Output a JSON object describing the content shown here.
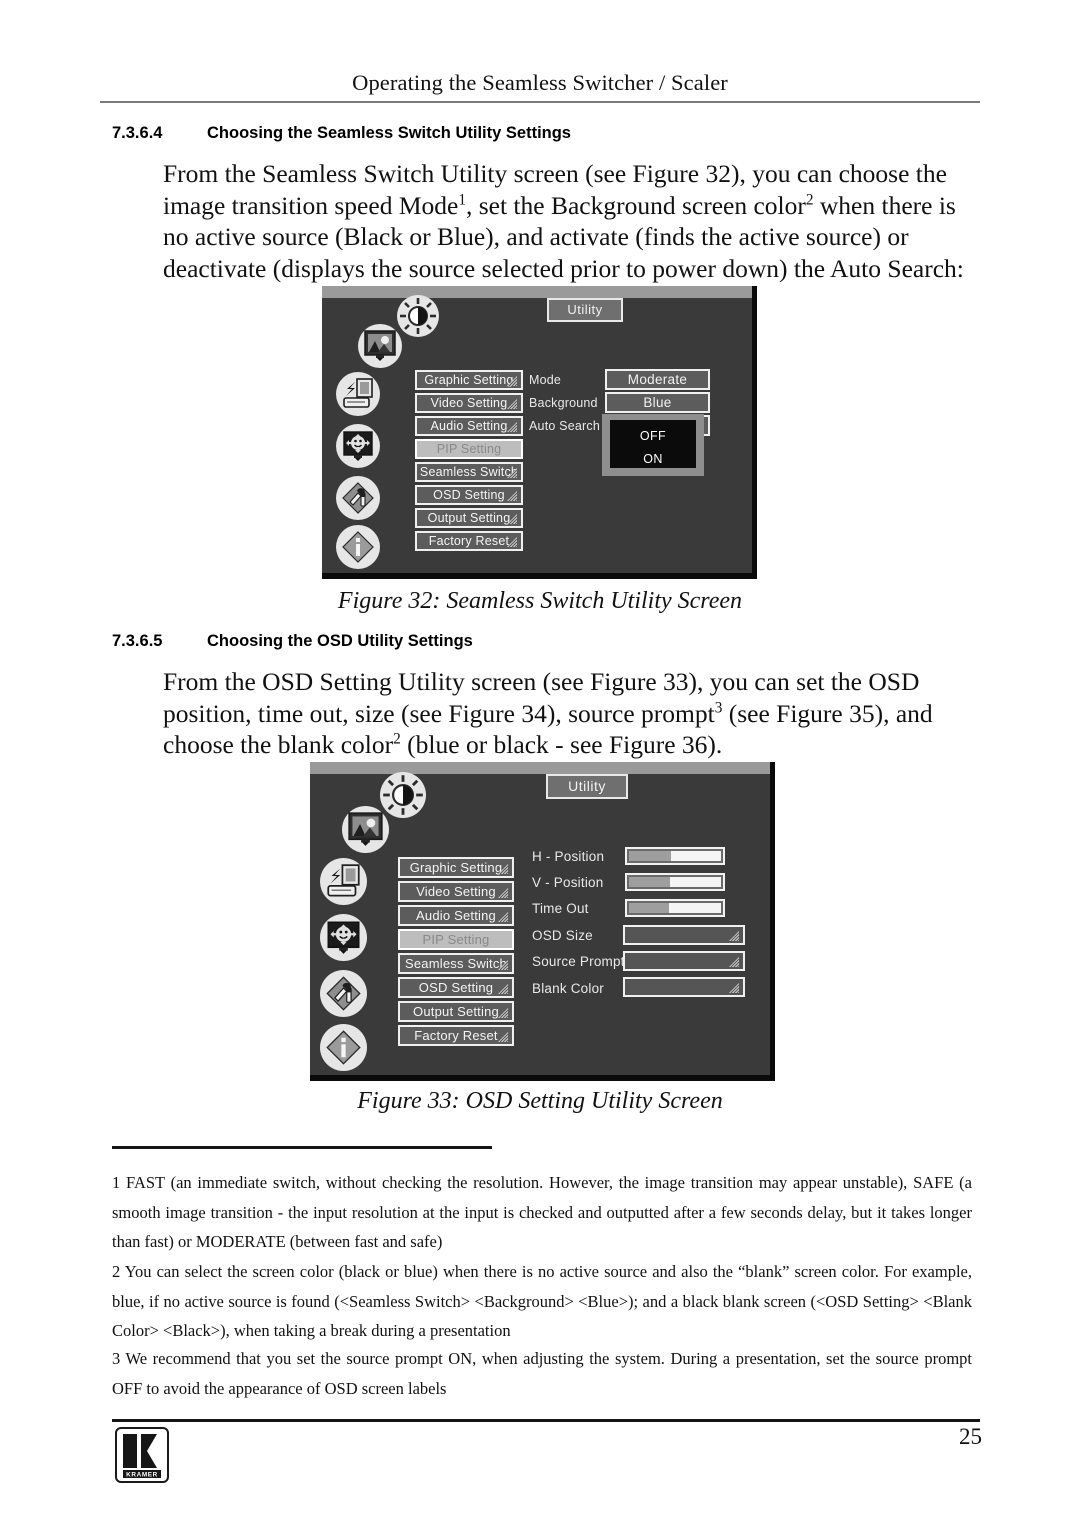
{
  "page": {
    "running_head": "Operating the Seamless Switcher / Scaler",
    "number": "25",
    "logo_text": "KRAMER"
  },
  "sections": [
    {
      "number": "7.3.6.4",
      "title": "Choosing the Seamless Switch Utility Settings",
      "body_line1": "From the Seamless Switch Utility screen (see Figure 32), you can choose the",
      "body_line2_a": "image transition speed Mode",
      "body_line2_sup1": "1",
      "body_line2_b": ", set the Background screen color",
      "body_line2_sup2": "2",
      "body_line2_c": " when there is",
      "body_line3": "no active source (Black or Blue), and activate (finds the active source) or",
      "body_line4": "deactivate (displays the source selected prior to power down) the Auto Search:"
    },
    {
      "number": "7.3.6.5",
      "title": "Choosing the OSD Utility Settings",
      "body_line1": "From the OSD Setting Utility screen (see Figure 33), you can set the OSD",
      "body_line2_a": "position, time out, size (see Figure 34), source prompt",
      "body_line2_sup3": "3",
      "body_line2_b": " (see Figure 35), and",
      "body_line3_a": "choose the blank color",
      "body_line3_sup2": "2",
      "body_line3_b": " (blue or black - see Figure 36)."
    }
  ],
  "figures": [
    {
      "caption": "Figure 32: Seamless Switch Utility Screen",
      "screen": {
        "title": "Utility",
        "rail_icons": [
          "brightness-contrast-icon",
          "picture-monitor-icon",
          "input-source-icon",
          "pip-monitor-icon",
          "tools-icon",
          "information-icon"
        ],
        "menu_items": [
          {
            "label": "Graphic Setting",
            "selected": false,
            "has_submenu": true
          },
          {
            "label": "Video Setting",
            "selected": false,
            "has_submenu": true
          },
          {
            "label": "Audio Setting",
            "selected": false,
            "has_submenu": true
          },
          {
            "label": "PIP Setting",
            "selected": true,
            "has_submenu": false
          },
          {
            "label": "Seamless Switch",
            "selected": false,
            "has_submenu": true
          },
          {
            "label": "OSD Setting",
            "selected": false,
            "has_submenu": true
          },
          {
            "label": "Output Setting",
            "selected": false,
            "has_submenu": true
          },
          {
            "label": "Factory Reset",
            "selected": false,
            "has_submenu": true
          }
        ],
        "fields": [
          {
            "label": "Mode",
            "value": "Moderate"
          },
          {
            "label": "Background",
            "value": "Blue"
          },
          {
            "label": "Auto Search",
            "value": ""
          }
        ],
        "dropdown": {
          "options": [
            "OFF",
            "ON"
          ]
        }
      }
    },
    {
      "caption": "Figure 33: OSD Setting Utility Screen",
      "screen": {
        "title": "Utility",
        "rail_icons": [
          "brightness-contrast-icon",
          "picture-monitor-icon",
          "input-source-icon",
          "pip-monitor-icon",
          "tools-icon",
          "information-icon"
        ],
        "menu_items": [
          {
            "label": "Graphic Setting",
            "selected": false,
            "has_submenu": true
          },
          {
            "label": "Video Setting",
            "selected": false,
            "has_submenu": true
          },
          {
            "label": "Audio Setting",
            "selected": false,
            "has_submenu": true
          },
          {
            "label": "PIP Setting",
            "selected": true,
            "has_submenu": false
          },
          {
            "label": "Seamless Switch",
            "selected": false,
            "has_submenu": true
          },
          {
            "label": "OSD Setting",
            "selected": false,
            "has_submenu": true
          },
          {
            "label": "Output Setting",
            "selected": false,
            "has_submenu": true
          },
          {
            "label": "Factory Reset",
            "selected": false,
            "has_submenu": true
          }
        ],
        "fields": [
          {
            "label": "H - Position",
            "type": "slider",
            "fill_percent": 46
          },
          {
            "label": "V - Position",
            "type": "slider",
            "fill_percent": 45
          },
          {
            "label": "Time Out",
            "type": "slider",
            "fill_percent": 44
          },
          {
            "label": "OSD Size",
            "type": "submenu"
          },
          {
            "label": "Source Prompt",
            "type": "submenu"
          },
          {
            "label": "Blank Color",
            "type": "submenu"
          }
        ]
      }
    }
  ],
  "footnotes": [
    "1 FAST (an immediate switch, without checking the resolution. However, the image transition may appear unstable), SAFE (a smooth image transition - the input resolution at the input is checked and outputted after a few seconds delay, but it takes longer than fast) or MODERATE (between fast and safe)",
    "2 You can select the screen color (black or blue) when there is no active source and also the “blank” screen color. For example, blue, if no active source is found (<Seamless Switch> <Background> <Blue>); and a black blank screen (<OSD Setting> <Blank Color> <Black>), when taking a break during a presentation",
    "3 We recommend that you set the source prompt ON, when adjusting the system. During a presentation, set the source prompt OFF to avoid the appearance of OSD screen labels"
  ]
}
